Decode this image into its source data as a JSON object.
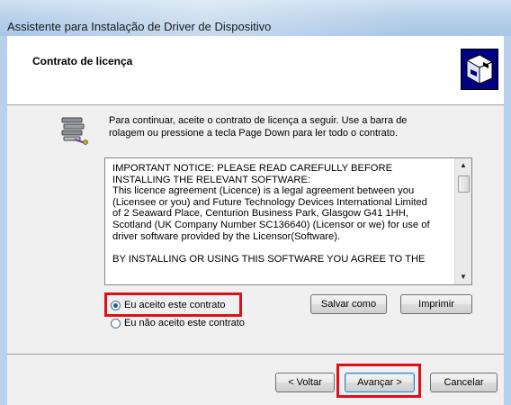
{
  "window": {
    "title": "Assistente para Instalação de Driver de Dispositivo"
  },
  "header": {
    "title": "Contrato de licença",
    "icon": "setup-wizard-icon"
  },
  "body": {
    "icon": "install-wizard-icon",
    "instructions": [
      "Para continuar, aceite o contrato de licença a seguir. Use a barra de",
      "rolagem ou pressione a tecla Page Down para ler todo o contrato."
    ],
    "license_lines": [
      "IMPORTANT NOTICE: PLEASE READ CAREFULLY BEFORE",
      "INSTALLING THE RELEVANT SOFTWARE:",
      "This licence agreement (Licence) is a legal agreement between you",
      "(Licensee or you) and Future Technology Devices International Limited",
      "of 2 Seaward Place, Centurion Business Park, Glasgow G41 1HH,",
      "Scotland (UK Company Number SC136640) (Licensor or we) for use of",
      "driver software provided by the Licensor(Software)."
    ],
    "license_last_line": "BY INSTALLING OR USING THIS SOFTWARE YOU AGREE TO THE"
  },
  "options": {
    "accept": {
      "label": "Eu aceito este contrato",
      "selected": true
    },
    "decline": {
      "label": "Eu não aceito este contrato",
      "selected": false
    }
  },
  "buttons": {
    "save_as": "Salvar como",
    "print": "Imprimir",
    "back": "< Voltar",
    "next": "Avançar >",
    "cancel": "Cancelar"
  },
  "colors": {
    "highlight": "#e0101a",
    "titlebar": "#b9d1ea"
  }
}
